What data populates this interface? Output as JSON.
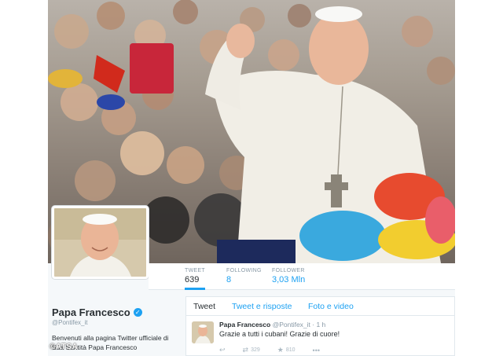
{
  "profile": {
    "name": "Papa Francesco",
    "handle": "@Pontifex_it",
    "bio": "Benvenuti alla pagina Twitter ufficiale di Sua Santità Papa Francesco",
    "verified_icon": "check-mark"
  },
  "stats": [
    {
      "label": "TWEET",
      "value": "639"
    },
    {
      "label": "FOLLOWING",
      "value": "8"
    },
    {
      "label": "FOLLOWER",
      "value": "3,03 Mln"
    }
  ],
  "tabs": [
    {
      "label": "Tweet"
    },
    {
      "label": "Tweet e risposte"
    },
    {
      "label": "Foto e video"
    }
  ],
  "tweet": {
    "author": "Papa Francesco",
    "handle": "@Pontifex_it",
    "time": "· 1 h",
    "text": "Grazie a tutti i cubani! Grazie di cuore!",
    "retweets": "329",
    "favorites": "810"
  },
  "watermark": "©ATSA",
  "colors": {
    "accent": "#1da1f2",
    "text": "#292f33",
    "muted": "#8899a6",
    "background": "#f5f8fa"
  }
}
